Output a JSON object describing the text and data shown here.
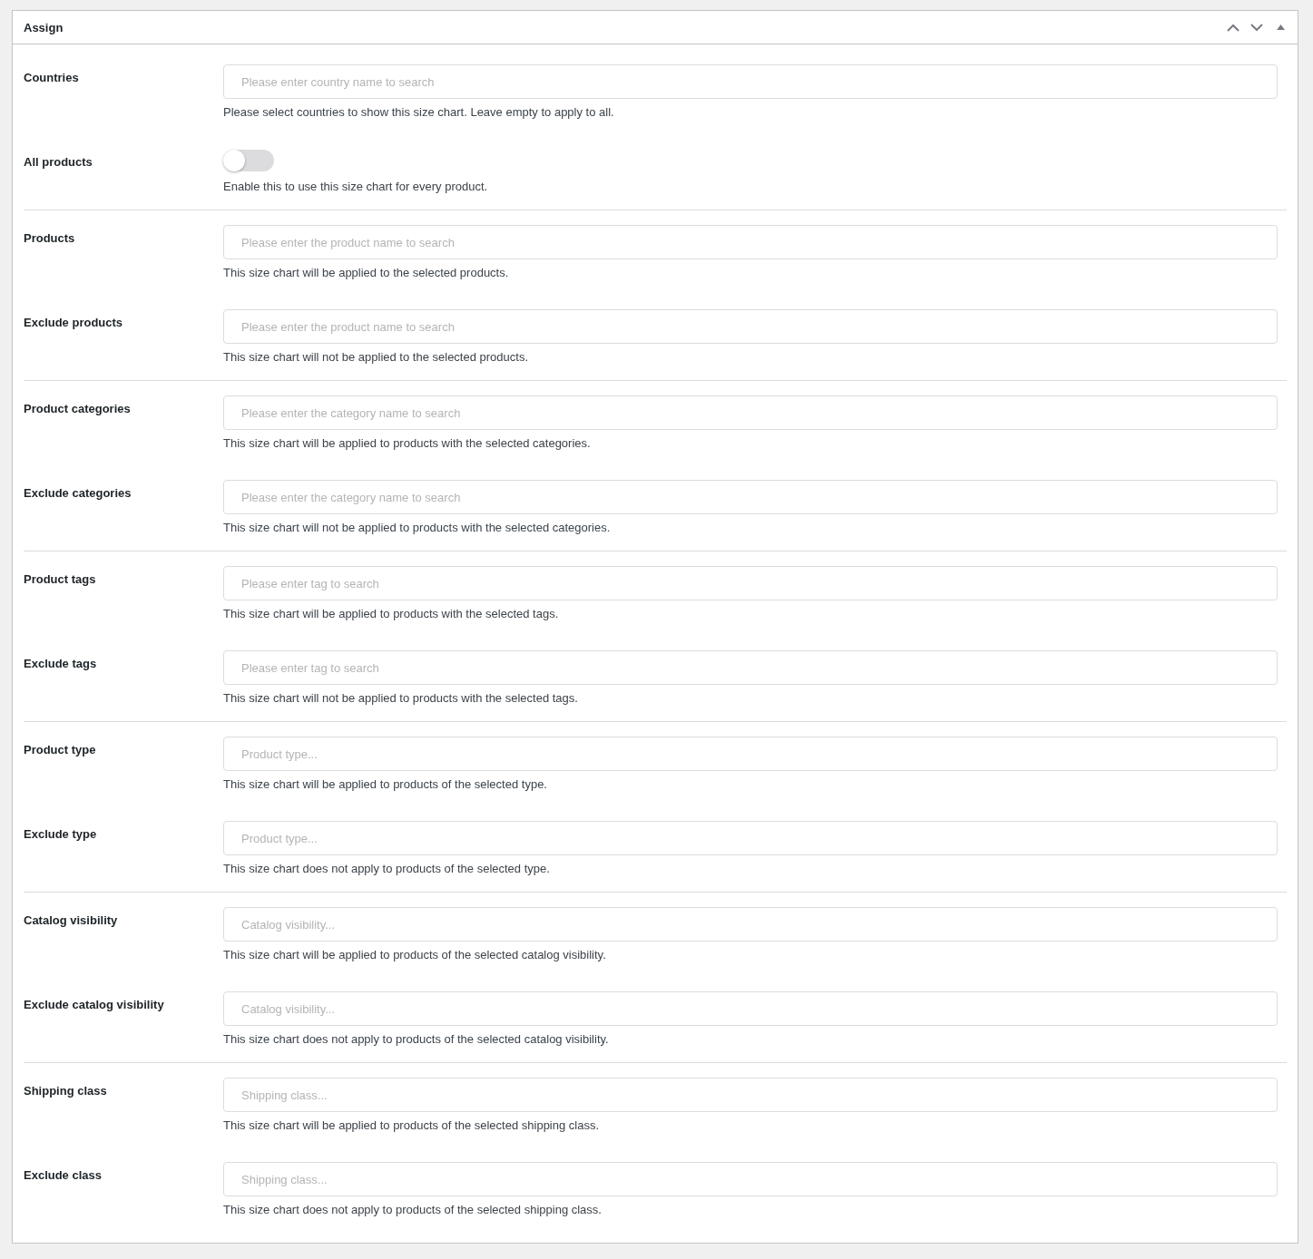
{
  "panel": {
    "title": "Assign"
  },
  "groups": [
    {
      "rows": [
        {
          "kind": "search",
          "label": "Countries",
          "placeholder": "Please enter country name to search",
          "hint": "Please select countries to show this size chart. Leave empty to apply to all."
        },
        {
          "kind": "toggle",
          "label": "All products",
          "on": false,
          "hint": "Enable this to use this size chart for every product."
        }
      ]
    },
    {
      "rows": [
        {
          "kind": "search",
          "label": "Products",
          "placeholder": "Please enter the product name to search",
          "hint": "This size chart will be applied to the selected products."
        },
        {
          "kind": "search",
          "label": "Exclude products",
          "placeholder": "Please enter the product name to search",
          "hint": "This size chart will not be applied to the selected products."
        }
      ]
    },
    {
      "rows": [
        {
          "kind": "search",
          "label": "Product categories",
          "placeholder": "Please enter the category name to search",
          "hint": "This size chart will be applied to products with the selected categories."
        },
        {
          "kind": "search",
          "label": "Exclude categories",
          "placeholder": "Please enter the category name to search",
          "hint": "This size chart will not be applied to products with the selected categories."
        }
      ]
    },
    {
      "rows": [
        {
          "kind": "search",
          "label": "Product tags",
          "placeholder": "Please enter tag to search",
          "hint": "This size chart will be applied to products with the selected tags."
        },
        {
          "kind": "search",
          "label": "Exclude tags",
          "placeholder": "Please enter tag to search",
          "hint": "This size chart will not be applied to products with the selected tags."
        }
      ]
    },
    {
      "rows": [
        {
          "kind": "search",
          "label": "Product type",
          "placeholder": "Product type...",
          "hint": "This size chart will be applied to products of the selected type."
        },
        {
          "kind": "search",
          "label": "Exclude type",
          "placeholder": "Product type...",
          "hint": "This size chart does not apply to products of the selected type."
        }
      ]
    },
    {
      "rows": [
        {
          "kind": "search",
          "label": "Catalog visibility",
          "placeholder": "Catalog visibility...",
          "hint": "This size chart will be applied to products of the selected catalog visibility."
        },
        {
          "kind": "search",
          "label": "Exclude catalog visibility",
          "placeholder": "Catalog visibility...",
          "hint": "This size chart does not apply to products of the selected catalog visibility."
        }
      ]
    },
    {
      "rows": [
        {
          "kind": "search",
          "label": "Shipping class",
          "placeholder": "Shipping class...",
          "hint": "This size chart will be applied to products of the selected shipping class."
        },
        {
          "kind": "search",
          "label": "Exclude class",
          "placeholder": "Shipping class...",
          "hint": "This size chart does not apply to products of the selected shipping class."
        }
      ]
    }
  ]
}
